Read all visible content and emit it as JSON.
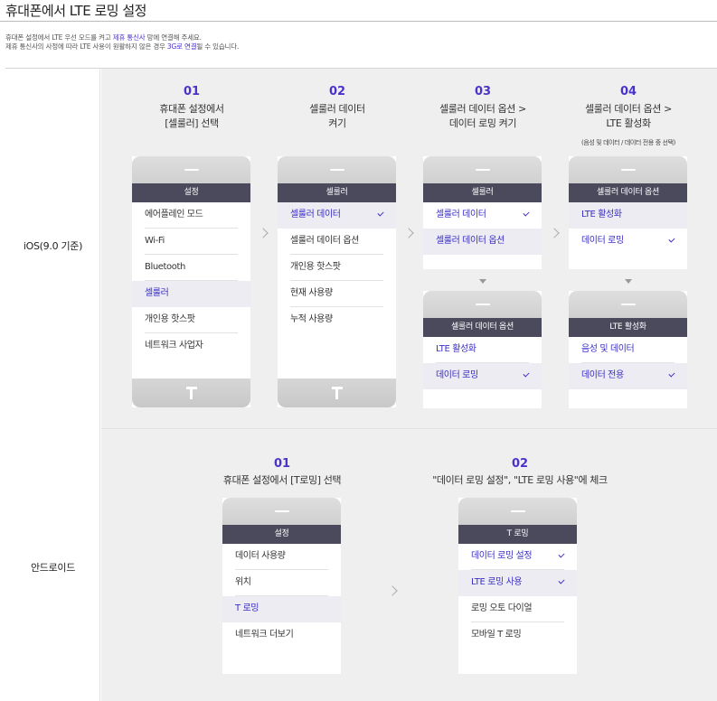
{
  "page": {
    "title": "휴대폰에서 LTE 로밍 설정",
    "intro_line1_before": "휴대폰 설정에서 LTE 우선 모드를 켜고 ",
    "intro_line1_link": "제휴 통신사",
    "intro_line1_after": " 망에 연결해 주세요.",
    "intro_line2_before": "제휴 통신사의 사정에 따라 LTE 사용이 원활하지 않은 경우 ",
    "intro_line2_link": "3G로 연결",
    "intro_line2_after": "될 수 있습니다."
  },
  "colors": {
    "accent": "#4a33c9",
    "header": "#4b4a5d",
    "panel": "#efefef"
  },
  "ios": {
    "label": "iOS(9.0 기준)",
    "steps": [
      {
        "num": "01",
        "title": "휴대폰 설정에서\n[셀룰러] 선택"
      },
      {
        "num": "02",
        "title": "셀룰러 데이터\n켜기"
      },
      {
        "num": "03",
        "title": "셀룰러 데이터 옵션 >\n데이터 로밍 켜기"
      },
      {
        "num": "04",
        "title": "셀룰러 데이터 옵션 >\nLTE 활성화",
        "note": "(음성 및 데이터 / 데이터 전용 중 선택)"
      }
    ],
    "phone1": {
      "header": "설정",
      "items": [
        "에어플레인 모드",
        "Wi-Fi",
        "Bluetooth",
        "셀룰러",
        "개인용 핫스팟",
        "네트워크 사업자"
      ]
    },
    "phone2": {
      "header": "셀룰러",
      "items": [
        "셀룰러 데이터",
        "셀룰러 데이터 옵션",
        "개인용 핫스팟",
        "현재 사용량",
        "누적 사용량"
      ]
    },
    "phone3a": {
      "header": "셀룰러",
      "items": [
        "셀룰러 데이터",
        "셀룰러 데이터 옵션"
      ]
    },
    "phone3b": {
      "header": "셀룰러 데이터 옵션",
      "items": [
        "LTE 활성화",
        "데이터 로밍"
      ]
    },
    "phone4a": {
      "header": "셀룰러 데이터 옵션",
      "items": [
        "LTE 활성화",
        "데이터 로밍"
      ]
    },
    "phone4b": {
      "header": "LTE 활성화",
      "items": [
        "음성 및 데이터",
        "데이터 전용"
      ]
    }
  },
  "android": {
    "label": "안드로이드",
    "steps": [
      {
        "num": "01",
        "title": "휴대폰 설정에서 [T로밍] 선택"
      },
      {
        "num": "02",
        "title": "\"데이터 로밍 설정\", \"LTE 로밍 사용\"에 체크"
      }
    ],
    "phone1": {
      "header": "설정",
      "items": [
        "데이터 사용량",
        "위치",
        "T 로밍",
        "네트워크 더보기"
      ]
    },
    "phone2": {
      "header": "T 로밍",
      "items": [
        "데이터 로밍 설정",
        "LTE 로밍 사용",
        "로밍 오토 다이얼",
        "모바일 T 로밍"
      ]
    }
  }
}
